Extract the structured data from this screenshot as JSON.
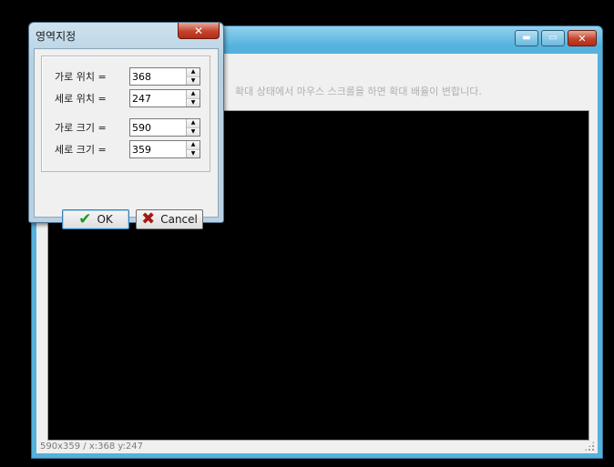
{
  "main_window": {
    "title": "",
    "controls": {
      "minimize_icon": "▬",
      "maximize_icon": "▭",
      "close_icon": "✕"
    },
    "hint": "확대 상태에서 마우스 스크롤을 하면 확대 배율이 변합니다.",
    "status": "590x359 / x:368 y:247"
  },
  "dialog": {
    "title": "영역지정",
    "close_icon": "✕",
    "fields": [
      {
        "label": "가로 위치 =",
        "value": "368"
      },
      {
        "label": "세로 위치 =",
        "value": "247"
      },
      {
        "label": "가로 크기 =",
        "value": "590"
      },
      {
        "label": "세로 크기 =",
        "value": "359"
      }
    ],
    "spin_up_icon": "▲",
    "spin_down_icon": "▼",
    "ok": {
      "icon": "✔",
      "label": "OK"
    },
    "cancel": {
      "icon": "✖",
      "label": "Cancel"
    }
  },
  "colors": {
    "title_bar_accent": "#55b1dd",
    "close_button": "#c5422c",
    "ok_icon": "#1e9a1e",
    "cancel_icon": "#a01a14"
  }
}
